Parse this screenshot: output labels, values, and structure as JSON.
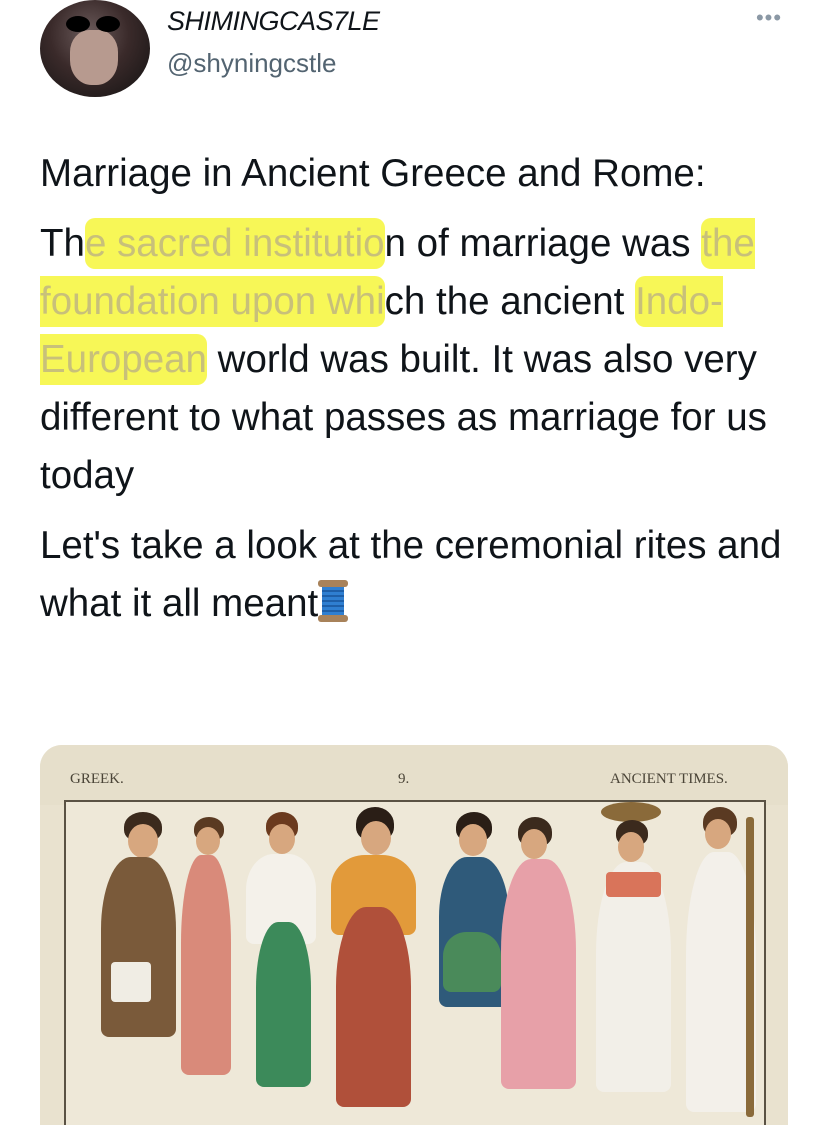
{
  "user": {
    "display_name": "SHIMINGCAS7LE",
    "handle": "@shyningcstle",
    "more_label": "•••"
  },
  "tweet": {
    "title_line": "Marriage in Ancient Greece and Rome:",
    "p2_seg1": "Th",
    "p2_hl1": "e sacred institutio",
    "p2_seg2": "n of marriage was",
    "p2_hl2": "the foundation upon whi",
    "p2_seg3": "ch the ancient",
    "p2_hl3": "Indo-European",
    "p2_seg4": " world was built. It was also very different to what passes as marriage for us today",
    "p3": "Let's take a look at the ceremonial rites and what it all meant",
    "emoji": "spool-of-thread"
  },
  "media": {
    "label_left": "GREEK.",
    "label_center": "9.",
    "label_right": "ANCIENT TIMES.",
    "image_subject": "illustrated plate of ancient Greek figures in draped garments"
  },
  "colors": {
    "highlight": "#f5f528",
    "text": "#0f1419",
    "secondary": "#536471"
  }
}
